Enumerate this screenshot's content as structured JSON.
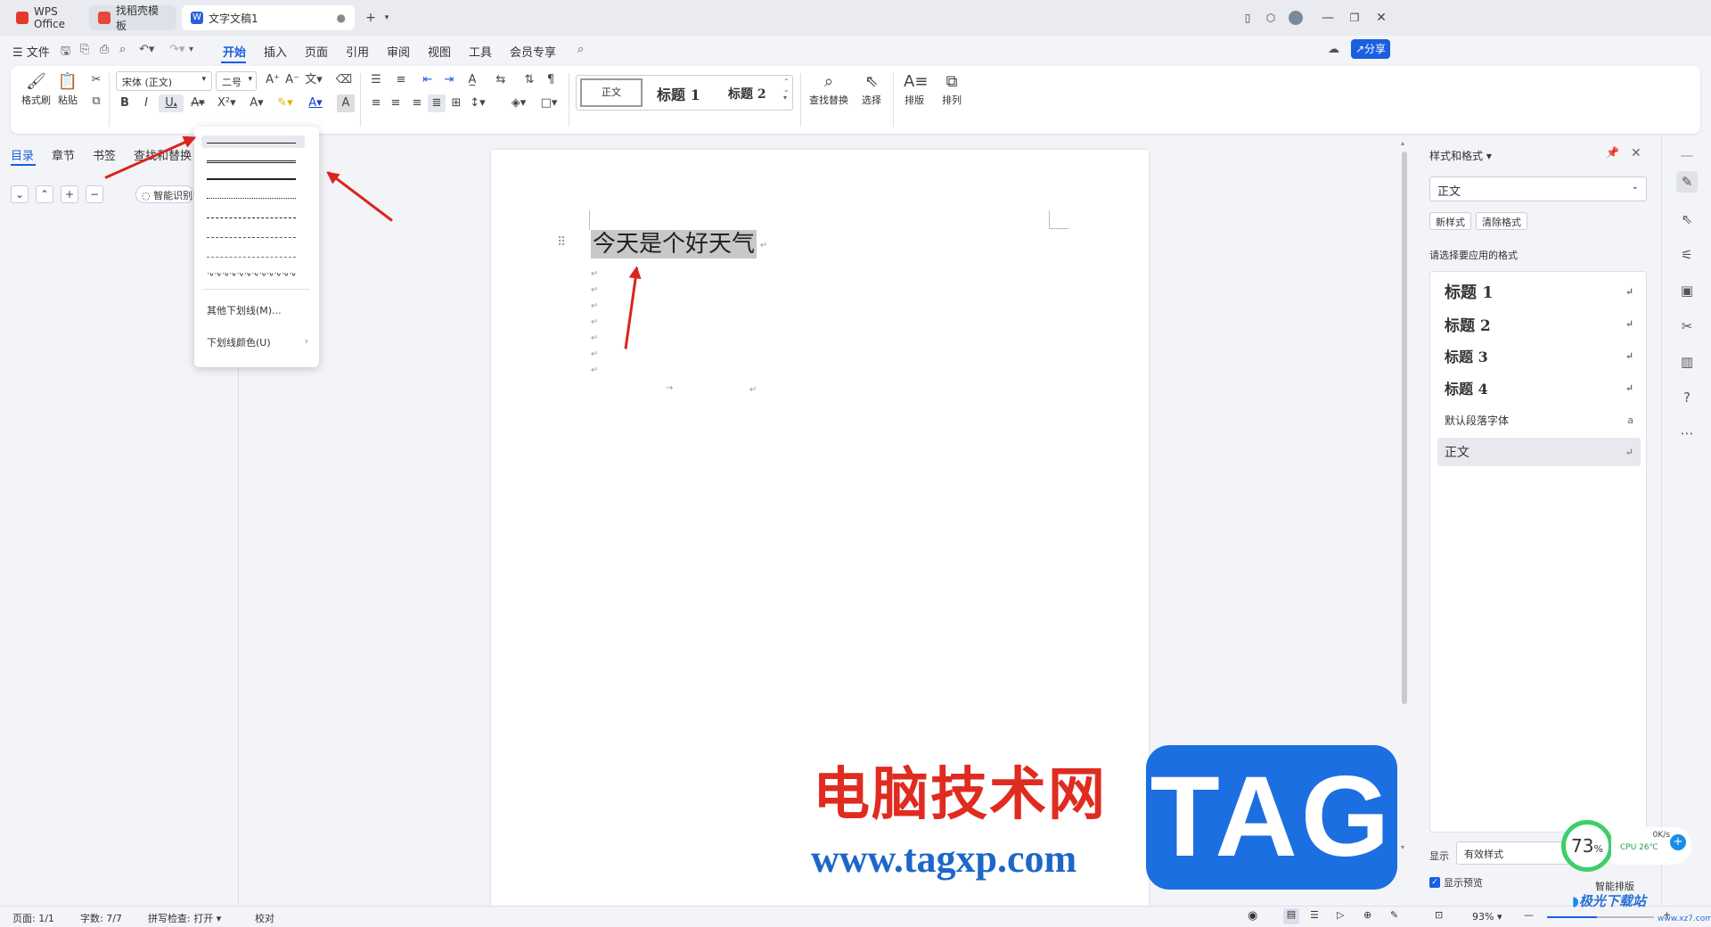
{
  "tabs": [
    {
      "label": "WPS Office",
      "icon": "wps-logo-icon",
      "color": "#e43a2c"
    },
    {
      "label": "找稻壳模板",
      "icon": "docer-icon",
      "color": "#e8473c"
    },
    {
      "label": "文字文稿1",
      "icon": "writer-doc-icon",
      "color": "#2b5fd9"
    }
  ],
  "menu": {
    "file": "文件",
    "items": [
      "开始",
      "插入",
      "页面",
      "引用",
      "审阅",
      "视图",
      "工具",
      "会员专享"
    ],
    "active": "开始",
    "share": "分享"
  },
  "ribbon": {
    "format_painter": "格式刷",
    "paste": "粘贴",
    "font_name": "宋体 (正文)",
    "font_size": "二号",
    "style_normal": "正文",
    "style_h1": "标题 1",
    "style_h2": "标题 2",
    "find_replace": "查找替换",
    "select": "选择",
    "layout": "排版",
    "arrange": "排列"
  },
  "nav": {
    "tabs": [
      "目录",
      "章节",
      "书签",
      "查找和替换"
    ],
    "active": "目录",
    "smart_recognize": "智能识别"
  },
  "underline_menu": {
    "more": "其他下划线(M)...",
    "color": "下划线颜色(U)"
  },
  "document": {
    "text": "今天是个好天气"
  },
  "styles_panel": {
    "title": "样式和格式",
    "current_style": "正文",
    "new_style": "新样式",
    "clear_format": "清除格式",
    "prompt": "请选择要应用的格式",
    "items": [
      "标题 1",
      "标题 2",
      "标题 3",
      "标题 4",
      "默认段落字体",
      "正文"
    ],
    "show_label": "显示",
    "show_value": "有效样式",
    "preview_label": "显示预览",
    "smart_layout": "智能排版"
  },
  "status": {
    "page": "页面: 1/1",
    "words": "字数: 7/7",
    "spell": "拼写检查: 打开",
    "proof": "校对",
    "zoom": "93%"
  },
  "widget": {
    "percent": "73",
    "unit": "%",
    "net": "0K/s",
    "cpu": "CPU 26℃"
  },
  "watermark": {
    "cn": "电脑技术网",
    "url": "www.tagxp.com",
    "tag": "TAG",
    "corner": "极光下载站",
    "corner_url": "www.xz7.com"
  }
}
